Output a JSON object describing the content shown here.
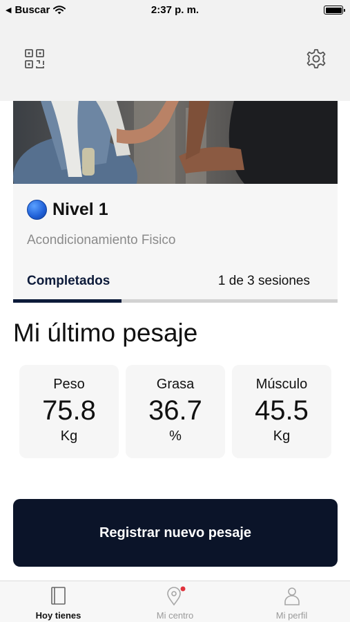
{
  "status_bar": {
    "back_label": "Buscar",
    "time": "2:37 p. m."
  },
  "header": {
    "left_icon": "qr-code-icon",
    "right_icon": "gear-icon"
  },
  "program_card": {
    "level_icon": "blue-circle",
    "level_title": "Nivel 1",
    "subtitle": "Acondicionamiento Fisico",
    "tab_label": "Completados",
    "sessions_text": "1 de 3 sesiones",
    "sessions_completed": 1,
    "sessions_total": 3
  },
  "weigh_in": {
    "title": "Mi último pesaje",
    "metrics": [
      {
        "label": "Peso",
        "value": "75.8",
        "unit": "Kg"
      },
      {
        "label": "Grasa",
        "value": "36.7",
        "unit": "%"
      },
      {
        "label": "Músculo",
        "value": "45.5",
        "unit": "Kg"
      }
    ],
    "button_label": "Registrar nuevo pesaje"
  },
  "tabbar": {
    "items": [
      {
        "label": "Hoy tienes",
        "icon": "book-icon",
        "active": true
      },
      {
        "label": "Mi centro",
        "icon": "location-pin-icon",
        "active": false,
        "badge": true
      },
      {
        "label": "Mi perfil",
        "icon": "person-icon",
        "active": false
      }
    ]
  },
  "colors": {
    "primary": "#0b1429",
    "card_bg": "#f6f6f6",
    "header_bg": "#f2f2f2",
    "badge": "#e0323c"
  }
}
